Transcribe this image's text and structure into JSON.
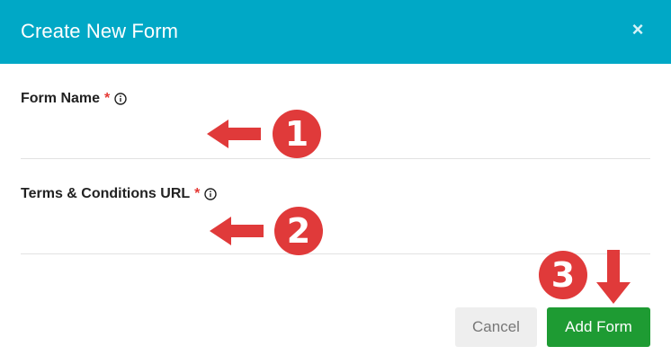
{
  "dialog": {
    "title": "Create New Form",
    "close_glyph": "×"
  },
  "fields": [
    {
      "label": "Form Name",
      "required_mark": "*",
      "value": "",
      "placeholder": ""
    },
    {
      "label": "Terms & Conditions URL",
      "required_mark": "*",
      "value": "",
      "placeholder": ""
    }
  ],
  "annotations": [
    {
      "number": "1",
      "direction": "left"
    },
    {
      "number": "2",
      "direction": "left"
    },
    {
      "number": "3",
      "direction": "down"
    }
  ],
  "buttons": {
    "cancel_label": "Cancel",
    "add_label": "Add Form"
  },
  "colors": {
    "header": "#00a8c6",
    "required": "#e53935",
    "annotation": "#e03a3a",
    "primary_button": "#1e9b33"
  },
  "icons": [
    "close-icon",
    "info-icon",
    "arrow-left-icon",
    "arrow-down-icon"
  ]
}
